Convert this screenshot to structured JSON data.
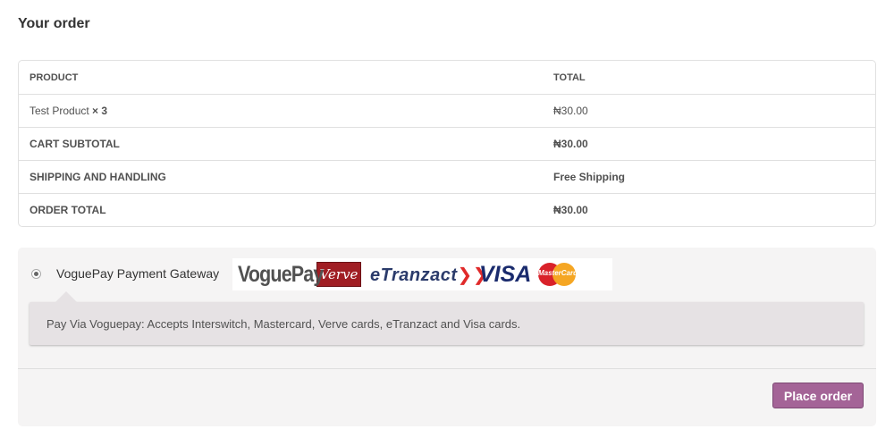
{
  "title": "Your order",
  "table": {
    "headers": {
      "product": "PRODUCT",
      "total": "TOTAL"
    },
    "item": {
      "name": "Test Product",
      "qty": "× 3",
      "total": "₦30.00"
    },
    "subtotal": {
      "label": "CART SUBTOTAL",
      "value": "₦30.00"
    },
    "shipping": {
      "label": "SHIPPING AND HANDLING",
      "value": "Free Shipping"
    },
    "order_total": {
      "label": "ORDER TOTAL",
      "value": "₦30.00"
    }
  },
  "payment": {
    "method_label": "VoguePay Payment Gateway",
    "selected": true,
    "logos": {
      "voguepay": "VoguePay",
      "verve": "Verve",
      "etranzact": "eTranzact",
      "visa": "VISA",
      "mastercard": "MasterCard"
    },
    "description": "Pay Via Voguepay: Accepts Interswitch, Mastercard, Verve cards, eTranzact and Visa cards."
  },
  "place_order_label": "Place order",
  "colors": {
    "accent": "#a46497",
    "panel": "#f5f4f4",
    "description_bg": "#e6e2e4"
  }
}
